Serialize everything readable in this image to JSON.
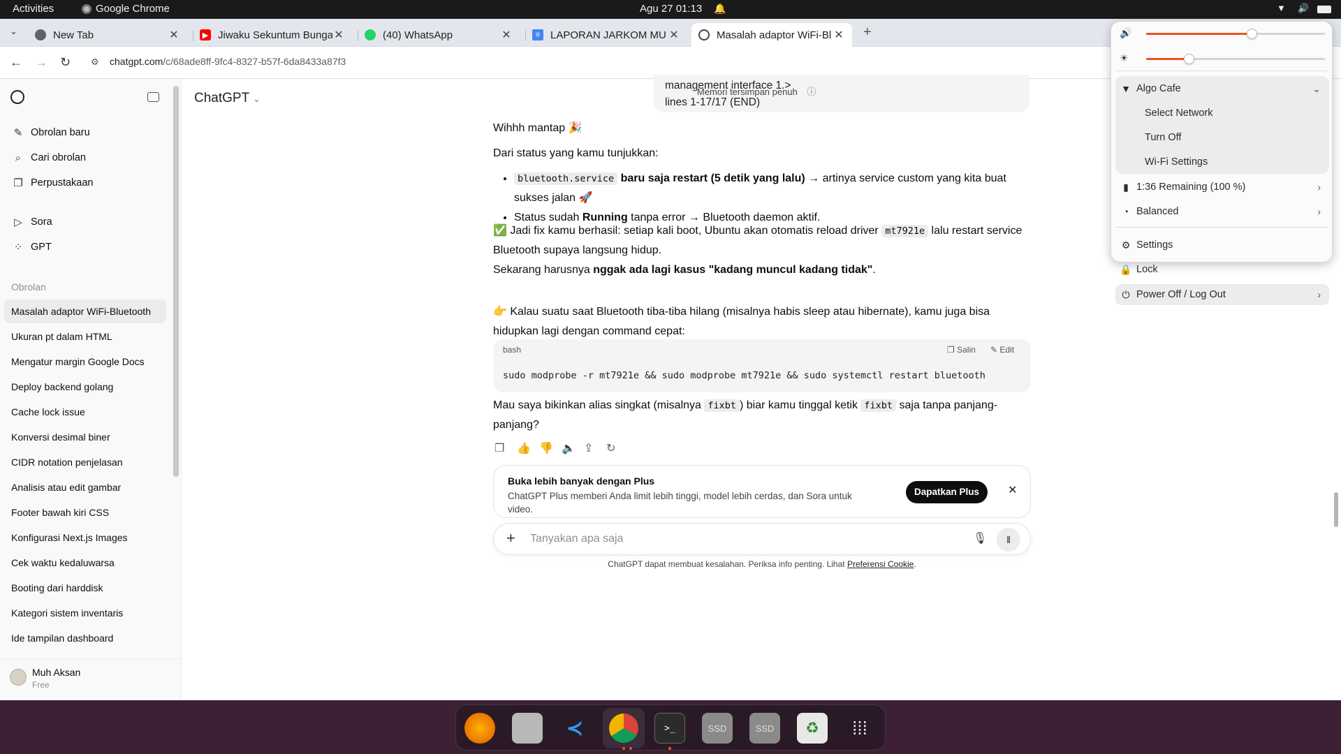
{
  "system_bar": {
    "activities": "Activities",
    "app_name": "Google Chrome",
    "datetime": "Agu 27  01:13"
  },
  "browser": {
    "tabs": [
      {
        "title": "New Tab",
        "icon": "chrome-icon",
        "color": "#5f6368"
      },
      {
        "title": "Jiwaku Sekuntum Bunga",
        "icon": "youtube-icon",
        "color": "#ff0000"
      },
      {
        "title": "(40) WhatsApp",
        "icon": "whatsapp-icon",
        "color": "#25d366"
      },
      {
        "title": "LAPORAN JARKOM MU",
        "icon": "docs-icon",
        "color": "#4285f4"
      },
      {
        "title": "Masalah adaptor WiFi-Bl",
        "icon": "chatgpt-icon",
        "color": "#444444"
      }
    ],
    "url_domain": "chatgpt.com",
    "url_path": "/c/68ade8ff-9fc4-8327-b57f-6da8433a87f3"
  },
  "sidebar": {
    "primary": [
      {
        "label": "Obrolan baru",
        "icon": "edit-icon"
      },
      {
        "label": "Cari obrolan",
        "icon": "search-icon"
      },
      {
        "label": "Perpustakaan",
        "icon": "library-icon"
      }
    ],
    "secondary": [
      {
        "label": "Sora",
        "icon": "play-icon"
      },
      {
        "label": "GPT",
        "icon": "grid-icon"
      }
    ],
    "section_label": "Obrolan",
    "chats": [
      "Masalah adaptor WiFi-Bluetooth",
      "Ukuran pt dalam HTML",
      "Mengatur margin Google Docs",
      "Deploy backend golang",
      "Cache lock issue",
      "Konversi desimal biner",
      "CIDR notation penjelasan",
      "Analisis atau edit gambar",
      "Footer bawah kiri CSS",
      "Konfigurasi Next.js Images",
      "Cek waktu kedaluwarsa",
      "Booting dari harddisk",
      "Kategori sistem inventaris",
      "Ide tampilan dashboard"
    ],
    "user_name": "Muh Aksan",
    "user_plan": "Free"
  },
  "main": {
    "model_label": "ChatGPT",
    "prev_line1": "management interface 1.>",
    "prev_line2": "lines 1-17/17 (END)",
    "prev_overlay": "Memori tersimpan penuh",
    "greeting": "Wihhh mantap 🎉",
    "intro": "Dari status yang kamu tunjukkan:",
    "b1_code": "bluetooth.service",
    "b1_bold": "baru saja restart (5 detik yang lalu)",
    "b1_rest": " → artinya service custom yang kita buat sukses jalan 🚀",
    "b2_pre": "Status sudah ",
    "b2_bold": "Running",
    "b2_rest": " tanpa error → Bluetooth daemon aktif.",
    "p3_pre": "✅ Jadi fix kamu berhasil: setiap kali boot, Ubuntu akan otomatis reload driver ",
    "p3_code": "mt7921e",
    "p3_rest": " lalu restart service Bluetooth supaya langsung hidup.",
    "p4_pre": "Sekarang harusnya ",
    "p4_bold": "nggak ada lagi kasus \"kadang muncul kadang tidak\"",
    "p4_rest": ".",
    "p5": "👉 Kalau suatu saat Bluetooth tiba-tiba hilang (misalnya habis sleep atau hibernate), kamu juga bisa hidupkan lagi dengan command cepat:",
    "code_lang": "bash",
    "copy_label": "Salin",
    "edit_label": "Edit",
    "code_text": "sudo modprobe -r mt7921e && sudo modprobe mt7921e && sudo systemctl restart bluetooth",
    "p6_a": "Mau saya bikinkan alias singkat (misalnya ",
    "p6_code1": "fixbt",
    "p6_b": ") biar kamu tinggal ketik ",
    "p6_code2": "fixbt",
    "p6_c": " saja tanpa panjang-panjang?",
    "plus_title": "Buka lebih banyak dengan Plus",
    "plus_desc": "ChatGPT Plus memberi Anda limit lebih tinggi, model lebih cerdas, dan Sora untuk video.",
    "plus_button": "Dapatkan Plus",
    "input_placeholder": "Tanyakan apa saja",
    "disclaimer": "ChatGPT dapat membuat kesalahan. Periksa info penting. Lihat ",
    "disclaimer_link": "Preferensi Cookie",
    "disclaimer_end": "."
  },
  "quick_settings": {
    "volume_level": 0.59,
    "brightness_level": 0.24,
    "wifi_network": "Algo Cafe",
    "select_network": "Select Network",
    "turn_off": "Turn Off",
    "wifi_settings": "Wi-Fi Settings",
    "battery": "1:36 Remaining (100 %)",
    "power_mode": "Balanced",
    "settings": "Settings",
    "lock": "Lock",
    "power_off": "Power Off / Log Out"
  },
  "dock": {
    "ssd1": "SSD",
    "ssd2": "SSD"
  },
  "colors": {
    "accent": "#e95420",
    "dock_bg": "#3d1f36"
  }
}
